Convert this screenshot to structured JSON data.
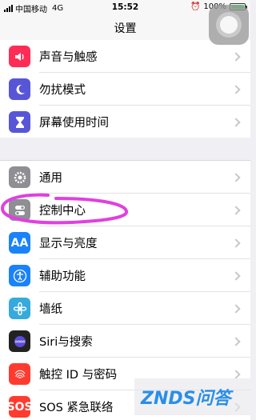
{
  "status_bar": {
    "carrier": "中国移动",
    "network": "4G",
    "time": "15:52",
    "battery_percent": "100%"
  },
  "nav": {
    "title": "设置"
  },
  "groups": [
    [
      {
        "label": "声音与触感",
        "icon": "speaker-icon",
        "color": "#ff2d55"
      },
      {
        "label": "勿扰模式",
        "icon": "moon-icon",
        "color": "#5856d6"
      },
      {
        "label": "屏幕使用时间",
        "icon": "hourglass-icon",
        "color": "#5856d6"
      }
    ],
    [
      {
        "label": "通用",
        "icon": "gear-icon",
        "color": "#8e8e93"
      },
      {
        "label": "控制中心",
        "icon": "toggles-icon",
        "color": "#8e8e93"
      },
      {
        "label": "显示与亮度",
        "icon": "text-size-icon",
        "color": "#1a82fb"
      },
      {
        "label": "辅助功能",
        "icon": "accessibility-icon",
        "color": "#1a82fb"
      },
      {
        "label": "墙纸",
        "icon": "flower-icon",
        "color": "#36aadc"
      },
      {
        "label": "Siri与搜索",
        "icon": "siri-icon",
        "color": "#222222"
      },
      {
        "label": "触控 ID 与密码",
        "icon": "fingerprint-icon",
        "color": "#ff3b30"
      },
      {
        "label": "SOS 紧急联络",
        "icon": "sos-icon",
        "color": "#ff3b30"
      }
    ]
  ],
  "icon_text": {
    "display": "AA",
    "sos": "SOS"
  },
  "annotation_color": "#e040e0"
}
